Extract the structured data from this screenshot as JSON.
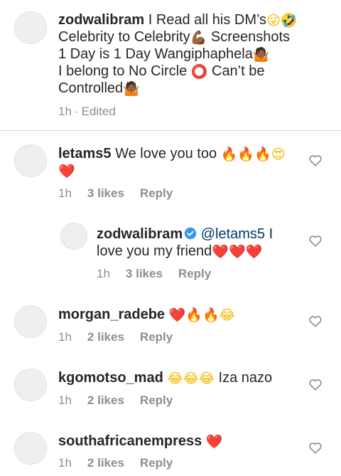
{
  "caption": {
    "username": "zodwalibram",
    "line1": "I Read all his DM’s",
    "line1_emojis": [
      "😜",
      "🤣"
    ],
    "line2a": "Celebrity to Celebrity",
    "line2_emoji": "💪🏾",
    "line2b": " Screenshots",
    "line3": "1 Day is 1 Day Wangiphaphela",
    "line3_emoji": "🤷🏾",
    "line4": "I belong to No Circle ",
    "line4_emoji": "⭕",
    "line4b": " Can’t be",
    "line5": "Controlled",
    "line5_emoji": "🤷🏾",
    "time": "1h",
    "separator": "·",
    "edited": "Edited"
  },
  "comments": [
    {
      "username": "letams5",
      "text": "We love you too",
      "emojis": [
        "🔥",
        "🔥",
        "🔥",
        "😍",
        "❤️"
      ],
      "time": "1h",
      "likes": "3 likes",
      "reply": "Reply"
    },
    {
      "username": "zodwalibram",
      "verified": true,
      "mention": "@letams5",
      "text_a": " I",
      "text_b": "love you my friend",
      "emojis": [
        "❤️",
        "❤️",
        "❤️"
      ],
      "time": "1h",
      "likes": "3 likes",
      "reply": "Reply"
    },
    {
      "username": "morgan_radebe",
      "emojis": [
        "❤️",
        "🔥",
        "🔥",
        "😂"
      ],
      "time": "1h",
      "likes": "2 likes",
      "reply": "Reply"
    },
    {
      "username": "kgomotso_mad",
      "emojis": [
        "😂",
        "😂",
        "😂"
      ],
      "text": "Iza nazo",
      "time": "1h",
      "likes": "2 likes",
      "reply": "Reply"
    },
    {
      "username": "southafricanempress",
      "emojis": [
        "❤️"
      ],
      "time": "1h",
      "likes": "2 likes",
      "reply": "Reply"
    }
  ],
  "colors": {
    "text": "#262626",
    "meta": "#8e8e8e",
    "mention": "#00376b",
    "verified": "#3897f0",
    "heart": "#ed2d3c"
  },
  "icons": {
    "like": "heart-outline-icon",
    "verified": "verified-badge-icon",
    "avatar": "avatar-placeholder"
  }
}
